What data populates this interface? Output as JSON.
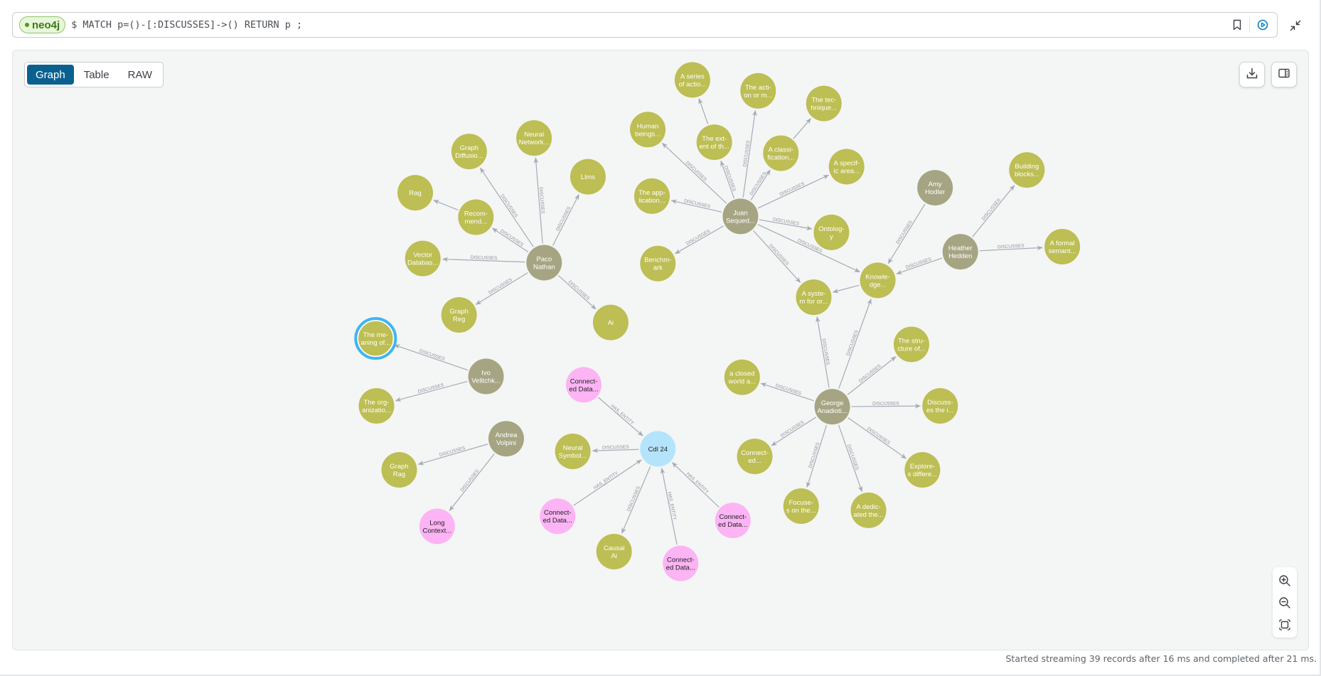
{
  "query_bar": {
    "database": "neo4j",
    "prompt": "$",
    "query": "MATCH p=()-[:DISCUSSES]->() RETURN p ;",
    "icons": [
      "bookmark-icon",
      "run-icon"
    ]
  },
  "collapse_icon": "collapse-icon",
  "view_tabs": [
    {
      "label": "Graph",
      "active": true
    },
    {
      "label": "Table",
      "active": false
    },
    {
      "label": "RAW",
      "active": false
    }
  ],
  "panel_buttons": [
    "download-icon",
    "details-panel-icon"
  ],
  "zoom_controls": [
    "zoom-in-icon",
    "zoom-out-icon",
    "fit-to-screen-icon"
  ],
  "status": "Started streaming 39 records after 16 ms and completed after 21 ms.",
  "colors": {
    "person": "#a6a583",
    "topic": "#bdbe53",
    "entity": "#fcb4f4",
    "event": "#b4e4fb",
    "selected_ring": "#3fb5f1",
    "edge": "#a5abb6",
    "accent": "#0a6190"
  },
  "graph": {
    "nodes": [
      {
        "id": "paco",
        "type": "person",
        "lines": [
          "Paco",
          "Nathan"
        ]
      },
      {
        "id": "graphdiff",
        "type": "topic",
        "lines": [
          "Graph",
          "Diffusio..."
        ]
      },
      {
        "id": "neuralnet",
        "type": "topic",
        "lines": [
          "Neural",
          "Network..."
        ]
      },
      {
        "id": "llms",
        "type": "topic",
        "lines": [
          "Llms"
        ]
      },
      {
        "id": "rag",
        "type": "topic",
        "lines": [
          "Rag"
        ]
      },
      {
        "id": "recommend",
        "type": "topic",
        "lines": [
          "Recom-",
          "mend..."
        ]
      },
      {
        "id": "vectordb",
        "type": "topic",
        "lines": [
          "Vector",
          "Databas..."
        ]
      },
      {
        "id": "graphreg",
        "type": "topic",
        "lines": [
          "Graph",
          "Reg"
        ]
      },
      {
        "id": "ai",
        "type": "topic",
        "lines": [
          "Ai"
        ]
      },
      {
        "id": "juan",
        "type": "person",
        "lines": [
          "Juan",
          "Sequed..."
        ]
      },
      {
        "id": "series",
        "type": "topic",
        "lines": [
          "A series",
          "of actio..."
        ]
      },
      {
        "id": "action",
        "type": "topic",
        "lines": [
          "The acti-",
          "on or m..."
        ]
      },
      {
        "id": "technique",
        "type": "topic",
        "lines": [
          "The tec-",
          "hnique..."
        ]
      },
      {
        "id": "human",
        "type": "topic",
        "lines": [
          "Human",
          "beings..."
        ]
      },
      {
        "id": "extent",
        "type": "topic",
        "lines": [
          "The ext-",
          "ent of th..."
        ]
      },
      {
        "id": "classif",
        "type": "topic",
        "lines": [
          "A classi-",
          "fication..."
        ]
      },
      {
        "id": "specific",
        "type": "topic",
        "lines": [
          "A specif-",
          "ic area..."
        ]
      },
      {
        "id": "application",
        "type": "topic",
        "lines": [
          "The app-",
          "lication..."
        ]
      },
      {
        "id": "ontology",
        "type": "topic",
        "lines": [
          "Ontolog-",
          "y"
        ]
      },
      {
        "id": "benchmark",
        "type": "topic",
        "lines": [
          "Benchm-",
          "ark"
        ]
      },
      {
        "id": "system",
        "type": "topic",
        "lines": [
          "A syste-",
          "m for or..."
        ]
      },
      {
        "id": "knowledge",
        "type": "topic",
        "lines": [
          "Knowle-",
          "dge..."
        ]
      },
      {
        "id": "amy",
        "type": "person",
        "lines": [
          "Amy",
          "Hodler"
        ]
      },
      {
        "id": "heather",
        "type": "person",
        "lines": [
          "Heather",
          "Hedden"
        ]
      },
      {
        "id": "building",
        "type": "topic",
        "lines": [
          "Building",
          "blocks..."
        ]
      },
      {
        "id": "formal",
        "type": "topic",
        "lines": [
          "A formal",
          "semant..."
        ]
      },
      {
        "id": "george",
        "type": "person",
        "lines": [
          "George",
          "Anadioti..."
        ]
      },
      {
        "id": "closed",
        "type": "topic",
        "lines": [
          "a closed",
          "world a..."
        ]
      },
      {
        "id": "structure",
        "type": "topic",
        "lines": [
          "The stru-",
          "cture of..."
        ]
      },
      {
        "id": "discusses_i",
        "type": "topic",
        "lines": [
          "Discuss-",
          "es the i..."
        ]
      },
      {
        "id": "connected_t",
        "type": "topic",
        "lines": [
          "Connect-",
          "ed..."
        ]
      },
      {
        "id": "explores",
        "type": "topic",
        "lines": [
          "Explore-",
          "s differe..."
        ]
      },
      {
        "id": "focuses",
        "type": "topic",
        "lines": [
          "Focuse-",
          "s on the..."
        ]
      },
      {
        "id": "dedicated",
        "type": "topic",
        "lines": [
          "A dedic-",
          "ated the..."
        ]
      },
      {
        "id": "meaning",
        "type": "topic",
        "lines": [
          "The me-",
          "aning of..."
        ],
        "selected": true
      },
      {
        "id": "ivo",
        "type": "person",
        "lines": [
          "Ivo",
          "Velitchk..."
        ]
      },
      {
        "id": "organization",
        "type": "topic",
        "lines": [
          "The org-",
          "anizatio..."
        ]
      },
      {
        "id": "andrea",
        "type": "person",
        "lines": [
          "Andrea",
          "Volpini"
        ]
      },
      {
        "id": "graphrag",
        "type": "topic",
        "lines": [
          "Graph",
          "Rag"
        ]
      },
      {
        "id": "longctx",
        "type": "entity",
        "lines": [
          "Long",
          "Context..."
        ]
      },
      {
        "id": "cdl24",
        "type": "event",
        "lines": [
          "Cdl 24"
        ]
      },
      {
        "id": "cd1",
        "type": "entity",
        "lines": [
          "Connect-",
          "ed Data..."
        ]
      },
      {
        "id": "neuralsym",
        "type": "topic",
        "lines": [
          "Neural",
          "Symbol..."
        ]
      },
      {
        "id": "cd2",
        "type": "entity",
        "lines": [
          "Connect-",
          "ed Data..."
        ]
      },
      {
        "id": "causal",
        "type": "topic",
        "lines": [
          "Causal",
          "Ai"
        ]
      },
      {
        "id": "cd3",
        "type": "entity",
        "lines": [
          "Connect-",
          "ed Data..."
        ]
      },
      {
        "id": "cd4",
        "type": "entity",
        "lines": [
          "Connect-",
          "ed Data..."
        ]
      }
    ],
    "edges": [
      {
        "from": "paco",
        "to": "graphdiff",
        "label": "DISCUSSES"
      },
      {
        "from": "paco",
        "to": "neuralnet",
        "label": "DISCUSSES"
      },
      {
        "from": "paco",
        "to": "llms",
        "label": "DISCUSSES"
      },
      {
        "from": "recommend",
        "to": "rag",
        "label": ""
      },
      {
        "from": "paco",
        "to": "recommend",
        "label": "DISCUSSES"
      },
      {
        "from": "paco",
        "to": "vectordb",
        "label": "DISCUSSES"
      },
      {
        "from": "paco",
        "to": "graphreg",
        "label": "DISCUSSES"
      },
      {
        "from": "paco",
        "to": "ai",
        "label": "DISCUSSES"
      },
      {
        "from": "extent",
        "to": "series",
        "label": ""
      },
      {
        "from": "juan",
        "to": "action",
        "label": "DISCUSSES"
      },
      {
        "from": "classif",
        "to": "technique",
        "label": ""
      },
      {
        "from": "juan",
        "to": "human",
        "label": "DISCUSSES"
      },
      {
        "from": "juan",
        "to": "extent",
        "label": "DISCUSSES"
      },
      {
        "from": "juan",
        "to": "classif",
        "label": "DISCUSSES"
      },
      {
        "from": "juan",
        "to": "specific",
        "label": "DISCUSSES"
      },
      {
        "from": "juan",
        "to": "application",
        "label": "DISCUSSES"
      },
      {
        "from": "juan",
        "to": "ontology",
        "label": "DISCUSSES"
      },
      {
        "from": "juan",
        "to": "benchmark",
        "label": "DISCUSSES"
      },
      {
        "from": "juan",
        "to": "system",
        "label": "DISCUSSES"
      },
      {
        "from": "juan",
        "to": "knowledge",
        "label": "DISCUSSES"
      },
      {
        "from": "knowledge",
        "to": "system",
        "label": ""
      },
      {
        "from": "amy",
        "to": "knowledge",
        "label": "DISCUSSES"
      },
      {
        "from": "heather",
        "to": "knowledge",
        "label": "DISCUSSES"
      },
      {
        "from": "heather",
        "to": "building",
        "label": "DISCUSSES"
      },
      {
        "from": "heather",
        "to": "formal",
        "label": "DISCUSSES"
      },
      {
        "from": "george",
        "to": "system",
        "label": "DISCUSSES"
      },
      {
        "from": "george",
        "to": "knowledge",
        "label": "DISCUSSES"
      },
      {
        "from": "george",
        "to": "closed",
        "label": "DISCUSSES"
      },
      {
        "from": "george",
        "to": "structure",
        "label": "DISCUSSES"
      },
      {
        "from": "george",
        "to": "discusses_i",
        "label": "DISCUSSES"
      },
      {
        "from": "george",
        "to": "connected_t",
        "label": "DISCUSSES"
      },
      {
        "from": "george",
        "to": "explores",
        "label": "DISCUSSES"
      },
      {
        "from": "george",
        "to": "focuses",
        "label": "DISCUSSES"
      },
      {
        "from": "george",
        "to": "dedicated",
        "label": "DISCUSSES"
      },
      {
        "from": "ivo",
        "to": "meaning",
        "label": "DISCUSSES"
      },
      {
        "from": "ivo",
        "to": "organization",
        "label": "DISCUSSES"
      },
      {
        "from": "andrea",
        "to": "graphrag",
        "label": "DISCUSSES"
      },
      {
        "from": "andrea",
        "to": "longctx",
        "label": "DISCUSSES"
      },
      {
        "from": "cd1",
        "to": "cdl24",
        "label": "HAS_ENTITY"
      },
      {
        "from": "cdl24",
        "to": "neuralsym",
        "label": "DISCUSSES"
      },
      {
        "from": "cd2",
        "to": "cdl24",
        "label": "HAS_ENTITY"
      },
      {
        "from": "cdl24",
        "to": "causal",
        "label": "DISCUSSES"
      },
      {
        "from": "cd3",
        "to": "cdl24",
        "label": "HAS_ENTITY"
      },
      {
        "from": "cd4",
        "to": "cdl24",
        "label": "HAS_ENTITY"
      }
    ]
  }
}
